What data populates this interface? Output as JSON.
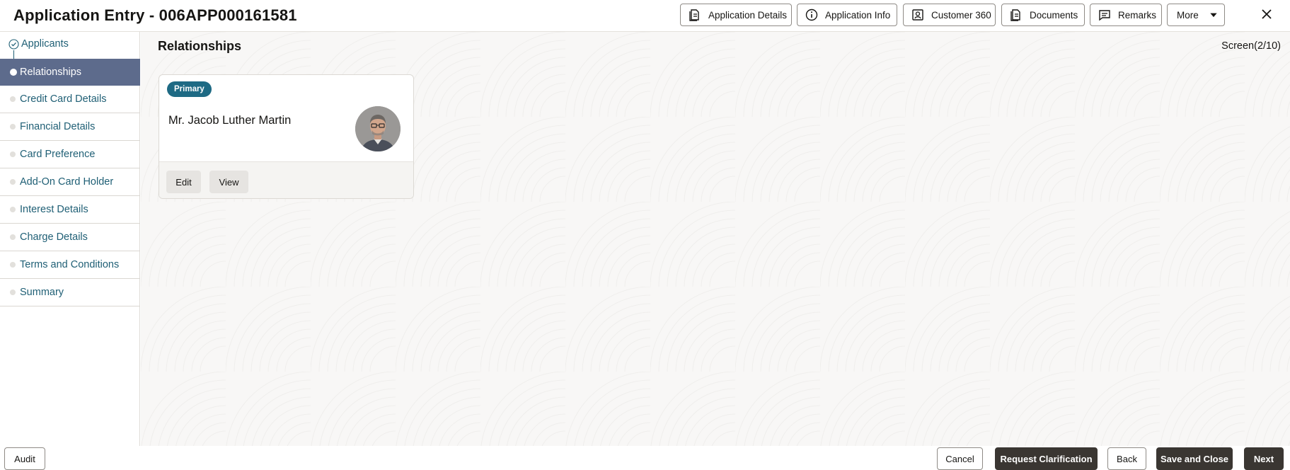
{
  "header": {
    "title": "Application Entry - 006APP000161581",
    "buttons": [
      {
        "label": "Application Details",
        "icon": "document-icon"
      },
      {
        "label": "Application Info",
        "icon": "info-icon"
      },
      {
        "label": "Customer 360",
        "icon": "customer-icon"
      },
      {
        "label": "Documents",
        "icon": "documents-icon"
      },
      {
        "label": "Remarks",
        "icon": "comment-icon"
      },
      {
        "label": "More",
        "icon": "caret-down-icon"
      }
    ]
  },
  "sidebar": {
    "items": [
      {
        "label": "Applicants",
        "state": "completed"
      },
      {
        "label": "Relationships",
        "state": "active"
      },
      {
        "label": "Credit Card Details",
        "state": "pending"
      },
      {
        "label": "Financial Details",
        "state": "pending"
      },
      {
        "label": "Card Preference",
        "state": "pending"
      },
      {
        "label": "Add-On Card Holder",
        "state": "pending"
      },
      {
        "label": "Interest Details",
        "state": "pending"
      },
      {
        "label": "Charge Details",
        "state": "pending"
      },
      {
        "label": "Terms and Conditions",
        "state": "pending"
      },
      {
        "label": "Summary",
        "state": "pending"
      }
    ]
  },
  "main": {
    "section_title": "Relationships",
    "screen_indicator": "Screen(2/10)",
    "card": {
      "badge": "Primary",
      "name": "Mr. Jacob Luther Martin",
      "edit_label": "Edit",
      "view_label": "View"
    }
  },
  "footer": {
    "audit": "Audit",
    "cancel": "Cancel",
    "request_clarification": "Request Clarification",
    "back": "Back",
    "save_and_close": "Save and Close",
    "next": "Next"
  },
  "colors": {
    "active_nav": "#5d6b8c",
    "link_text": "#1f5f75",
    "badge": "#1e6a84",
    "primary_button": "#3a3632"
  }
}
